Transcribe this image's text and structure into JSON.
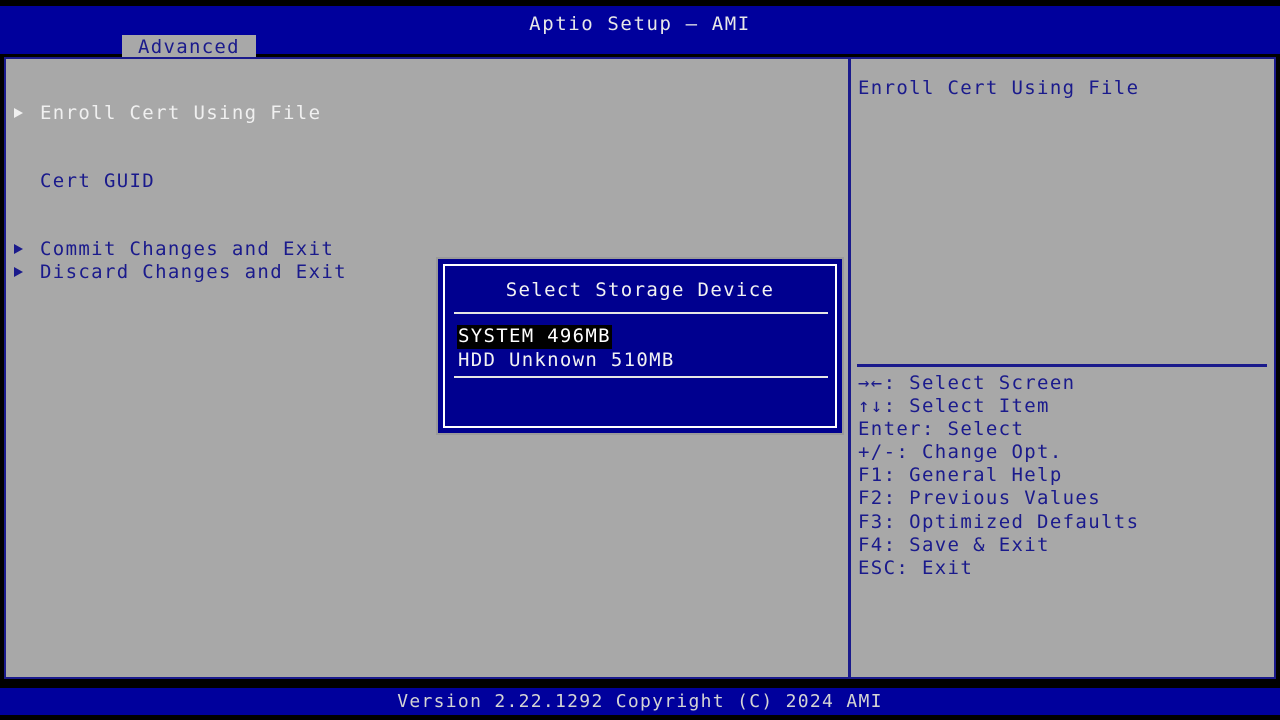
{
  "header": {
    "title": "Aptio Setup – AMI",
    "tabs": [
      {
        "id": "advanced",
        "label": "Advanced",
        "active": true
      }
    ]
  },
  "menu": {
    "items": [
      {
        "id": "enroll-cert-using-file",
        "label": "Enroll Cert Using File",
        "has_submenu": true,
        "selected": true
      },
      {
        "id": "cert-guid",
        "label": "Cert GUID",
        "has_submenu": false,
        "selected": false
      },
      {
        "id": "commit-changes-and-exit",
        "label": "Commit Changes and Exit",
        "has_submenu": true,
        "selected": false
      },
      {
        "id": "discard-changes-and-exit",
        "label": "Discard Changes and Exit",
        "has_submenu": true,
        "selected": false
      }
    ]
  },
  "help": {
    "description": "Enroll Cert Using File",
    "keys": [
      {
        "key": "→←:",
        "action": "Select Screen"
      },
      {
        "key": "↑↓:",
        "action": "Select Item"
      },
      {
        "key": "Enter:",
        "action": "Select"
      },
      {
        "key": "+/-:",
        "action": "Change Opt."
      },
      {
        "key": "F1:",
        "action": "General Help"
      },
      {
        "key": "F2:",
        "action": "Previous Values"
      },
      {
        "key": "F3:",
        "action": "Optimized Defaults"
      },
      {
        "key": "F4:",
        "action": "Save & Exit"
      },
      {
        "key": "ESC:",
        "action": "Exit"
      }
    ]
  },
  "dialog": {
    "title": "Select Storage Device",
    "options": [
      {
        "id": "system-496mb",
        "label": "SYSTEM 496MB",
        "selected": true
      },
      {
        "id": "hdd-unknown-510mb",
        "label": "HDD Unknown 510MB",
        "selected": false
      }
    ]
  },
  "footer": {
    "version_text": "Version 2.22.1292 Copyright (C) 2024 AMI"
  },
  "colors": {
    "screen_bg": "#000000",
    "bar_blue": "#00009c",
    "panel_gray": "#a8a8a8",
    "border_blue": "#1a1a8c",
    "text_blue": "#1a1a8c",
    "text_white": "#f0f0f0",
    "dialog_blue": "#00008f",
    "highlight_black": "#000000"
  }
}
